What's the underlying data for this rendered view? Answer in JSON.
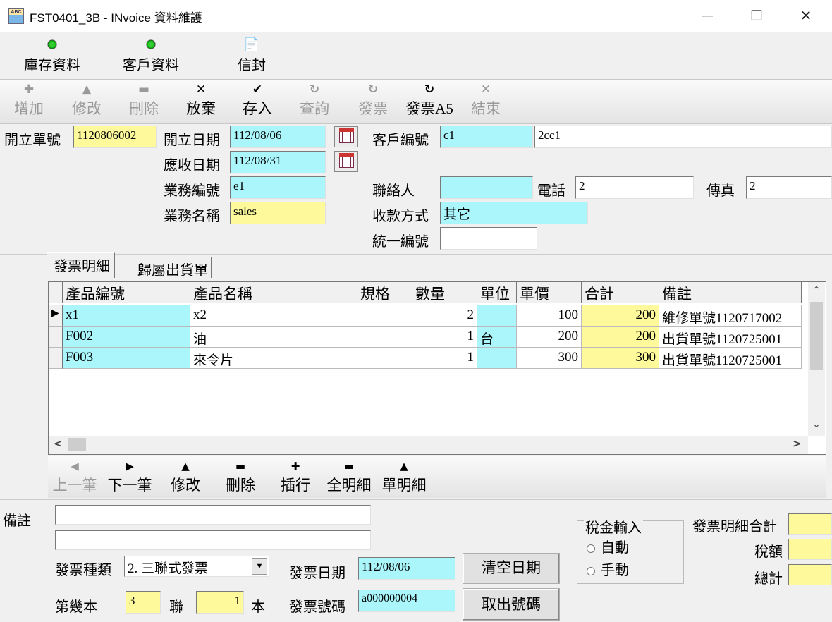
{
  "window": {
    "title": "FST0401_3B - INvoice 資料維護",
    "minimize": "—",
    "maximize": "☐",
    "close": "✕"
  },
  "toolbar1": [
    {
      "label": "庫存資料",
      "icon": "green-dot-icon"
    },
    {
      "label": "客戶資料",
      "icon": "green-dot-icon"
    },
    {
      "label": "信封",
      "icon": "envelope-icon"
    }
  ],
  "toolbar2": [
    {
      "label": "增加",
      "glyph": "✚",
      "enabled": false
    },
    {
      "label": "修改",
      "glyph": "▲",
      "enabled": false
    },
    {
      "label": "刪除",
      "glyph": "▬",
      "enabled": false
    },
    {
      "label": "放棄",
      "glyph": "✕",
      "enabled": true
    },
    {
      "label": "存入",
      "glyph": "✔",
      "enabled": true
    },
    {
      "label": "查詢",
      "glyph": "↻",
      "enabled": false
    },
    {
      "label": "發票",
      "glyph": "↻",
      "enabled": false
    },
    {
      "label": "發票A5",
      "glyph": "↻",
      "enabled": true
    },
    {
      "label": "結束",
      "glyph": "✕",
      "enabled": false
    }
  ],
  "form": {
    "order_no_label": "開立單號",
    "order_no": "1120806002",
    "open_date_label": "開立日期",
    "open_date": "112/08/06",
    "due_date_label": "應收日期",
    "due_date": "112/08/31",
    "sales_no_label": "業務編號",
    "sales_no": "e1",
    "sales_name_label": "業務名稱",
    "sales_name": "sales",
    "cust_no_label": "客戶編號",
    "cust_no": "c1",
    "cust_name": "2cc1",
    "contact_label": "聯絡人",
    "contact": "",
    "phone_label": "電話",
    "phone": "2",
    "fax_label": "傳真",
    "fax": "2",
    "payment_label": "收款方式",
    "payment": "其它",
    "tax_id_label": "統一編號",
    "tax_id": ""
  },
  "tabs": [
    {
      "label": "發票明細",
      "active": true
    },
    {
      "label": "歸屬出貨單",
      "active": false
    }
  ],
  "grid": {
    "columns": [
      "產品編號",
      "產品名稱",
      "規格",
      "數量",
      "單位",
      "單價",
      "合計",
      "備註"
    ],
    "rows": [
      [
        "x1",
        "x2",
        "",
        "2",
        "",
        "100",
        "200",
        "維修單號1120717002"
      ],
      [
        "F002",
        "油",
        "",
        "1",
        "台",
        "200",
        "200",
        "出貨單號1120725001"
      ],
      [
        "F003",
        "來令片",
        "",
        "1",
        "",
        "300",
        "300",
        "出貨單號1120725001"
      ]
    ],
    "current_row_marker": "▶",
    "scroll_up": "⌃",
    "scroll_down": "⌄",
    "scroll_left": "<",
    "scroll_right": ">"
  },
  "toolbar3": [
    {
      "label": "上一筆",
      "glyph": "◀",
      "enabled": false
    },
    {
      "label": "下一筆",
      "glyph": "▶",
      "enabled": true
    },
    {
      "label": "修改",
      "glyph": "▲",
      "enabled": true
    },
    {
      "label": "刪除",
      "glyph": "▬",
      "enabled": true
    },
    {
      "label": "插行",
      "glyph": "✚",
      "enabled": true
    },
    {
      "label": "全明細",
      "glyph": "▬",
      "enabled": true
    },
    {
      "label": "單明細",
      "glyph": "▲",
      "enabled": true
    }
  ],
  "bottom": {
    "remark_label": "備註",
    "remark1": "",
    "remark2": "",
    "invoice_type_label": "發票種類",
    "invoice_type": "2. 三聯式發票",
    "invoice_date_label": "發票日期",
    "invoice_date": "112/08/06",
    "clear_date_button": "清空日期",
    "book_label": "第幾本",
    "book": "3",
    "copy_label": "聯",
    "copy": "1",
    "book_unit": "本",
    "invoice_no_label": "發票號碼",
    "invoice_no": "a000000004",
    "get_no_button": "取出號碼",
    "tax_group_label": "稅金輸入",
    "tax_auto": "自動",
    "tax_manual": "手動",
    "detail_total_label": "發票明細合計",
    "tax_amount_label": "稅額",
    "grand_total_label": "總計"
  },
  "colors": {
    "cyan_field": "#aaf6fb",
    "yellow_field": "#fefa9c"
  }
}
